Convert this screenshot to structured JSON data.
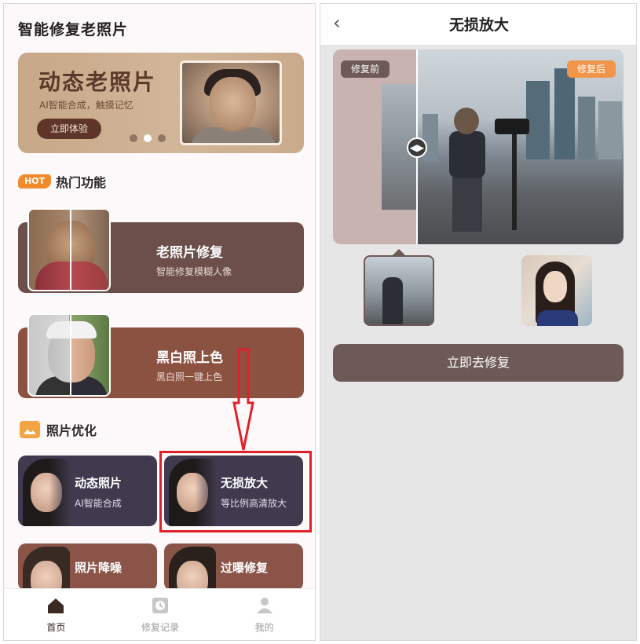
{
  "home": {
    "app_title": "智能修复老照片",
    "banner": {
      "title": "动态老照片",
      "subtitle": "AI智能合成，触摸记忆",
      "button": "立即体验",
      "carousel_active": 2,
      "carousel_total": 3
    },
    "hot_section": {
      "badge": "HOT",
      "title": "热门功能",
      "cards": [
        {
          "title": "老照片修复",
          "subtitle": "智能修复模糊人像"
        },
        {
          "title": "黑白照上色",
          "subtitle": "黑白照一键上色"
        }
      ]
    },
    "optimize_section": {
      "title": "照片优化",
      "tiles": [
        {
          "title": "动态照片",
          "subtitle": "AI智能合成"
        },
        {
          "title": "无损放大",
          "subtitle": "等比例高清放大"
        },
        {
          "title": "照片降噪",
          "subtitle": ""
        },
        {
          "title": "过曝修复",
          "subtitle": ""
        }
      ]
    },
    "tabbar": {
      "items": [
        {
          "label": "首页",
          "icon": "home-icon",
          "active": true
        },
        {
          "label": "修复记录",
          "icon": "clock-icon",
          "active": false
        },
        {
          "label": "我的",
          "icon": "user-icon",
          "active": false
        }
      ]
    }
  },
  "upscale": {
    "nav_title": "无损放大",
    "back_icon": "chevron-left-icon",
    "before_label": "修复前",
    "after_label": "修复后",
    "cta": "立即去修复"
  },
  "colors": {
    "accent_brown": "#6d5955",
    "hot_orange": "#f08a2a",
    "highlight_red": "#e0202a"
  }
}
